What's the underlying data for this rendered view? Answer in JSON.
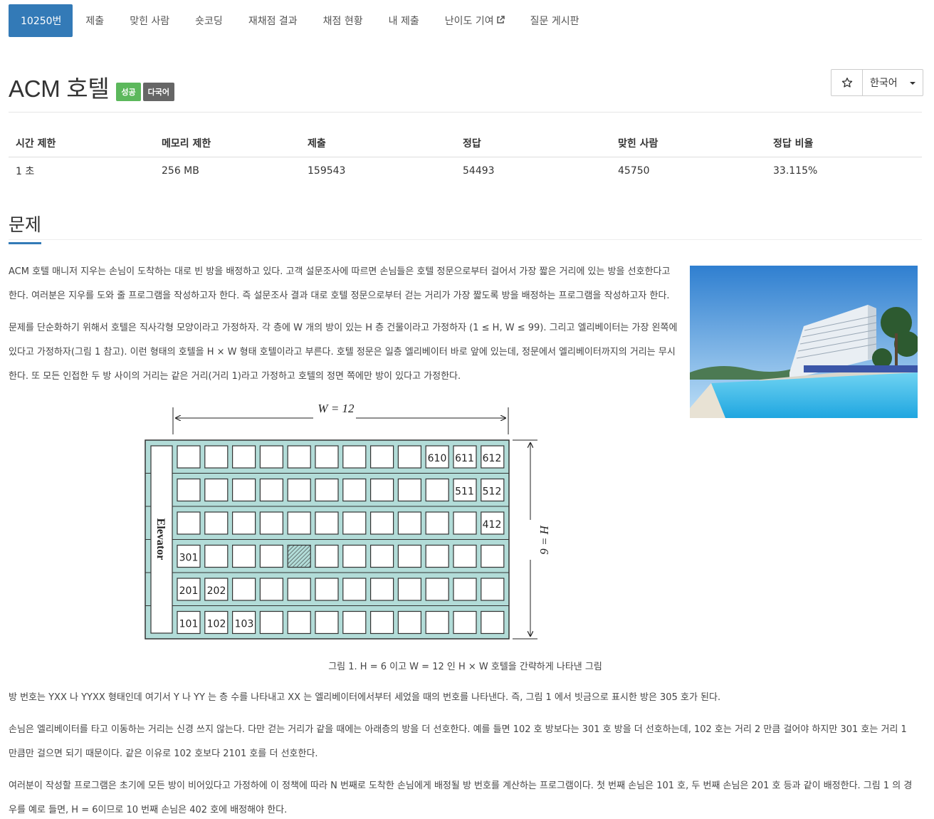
{
  "tabs": [
    {
      "label": "10250번",
      "active": true
    },
    {
      "label": "제출"
    },
    {
      "label": "맞힌 사람"
    },
    {
      "label": "숏코딩"
    },
    {
      "label": "재채점 결과"
    },
    {
      "label": "채점 현황"
    },
    {
      "label": "내 제출"
    },
    {
      "label": "난이도 기여",
      "external": true
    },
    {
      "label": "질문 게시판"
    }
  ],
  "problem": {
    "title": "ACM 호텔",
    "badges": {
      "success": "성공",
      "multilang": "다국어"
    },
    "language": "한국어",
    "star_icon": "star-icon"
  },
  "info": {
    "headers": [
      "시간 제한",
      "메모리 제한",
      "제출",
      "정답",
      "맞힌 사람",
      "정답 비율"
    ],
    "values": [
      "1 초",
      "256 MB",
      "159543",
      "54493",
      "45750",
      "33.115%"
    ]
  },
  "section": {
    "title": "문제"
  },
  "paragraphs": {
    "p1a": "ACM 호텔 매니저 지우는 손님이 도착하는 대로 빈 방을 배정하고 있다. 고객 설문조사에 따르면 손님들은 호텔 정문으로부터 걸어서 가장 짧은 거리에 있는 방을 선호한다고",
    "p1b": "한다. 여러분은 지우를 도와 줄 프로그램을 작성하고자 한다. 즉 설문조사 결과 대로 호텔 정문으로부터 걷는 거리가 가장 짧도록 방을 배정하는 프로그램을 작성하고자 한다.",
    "p2a": "문제를 단순화하기 위해서 호텔은 직사각형 모양이라고 가정하자. 각 층에 W 개의 방이 있는 H 층 건물이라고 가정하자 (1 ≤ H, W ≤ 99). 그리고 엘리베이터는 가장 왼쪽에",
    "p2b": "있다고 가정하자(그림 1 참고). 이런 형태의 호텔을 H × W 형태 호텔이라고 부른다. 호텔 정문은 일층 엘리베이터 바로 앞에 있는데, 정문에서 엘리베이터까지의 거리는 무시",
    "p2c": "한다. 또 모든 인접한 두 방 사이의 거리는 같은 거리(거리 1)라고 가정하고 호텔의 정면 쪽에만 방이 있다고 가정한다.",
    "caption": "그림 1. H = 6 이고 W = 12 인 H × W 호텔을 간략하게 나타낸 그림",
    "p3": "방 번호는 YXX 나 YYXX 형태인데 여기서 Y 나 YY 는 층 수를 나타내고 XX 는 엘리베이터에서부터 세었을 때의 번호를 나타낸다. 즉, 그림 1 에서 빗금으로 표시한 방은 305 호가 된다.",
    "p4a": "손님은 엘리베이터를 타고 이동하는 거리는 신경 쓰지 않는다. 다만 걷는 거리가 같을 때에는 아래층의 방을 더 선호한다. 예를 들면 102 호 방보다는 301 호 방을 더 선호하는데, 102 호는 거리 2 만큼 걸어야 하지만 301 호는 거리 1",
    "p4b": "만큼만 걸으면 되기 때문이다. 같은 이유로 102 호보다 2101 호를 더 선호한다.",
    "p5a": "여러분이 작성할 프로그램은 초기에 모든 방이 비어있다고 가정하에 이 정책에 따라 N 번째로 도착한 손님에게 배정될 방 번호를 계산하는 프로그램이다. 첫 번째 손님은 101 호, 두 번째 손님은 201 호 등과 같이 배정한다. 그림 1 의 경",
    "p5b": "우를 예로 들면, H = 6이므로 10 번째 손님은 402 호에 배정해야 한다."
  },
  "figure": {
    "w_label": "W = 12",
    "h_label": "H = 6",
    "elevator_label": "Elevator",
    "rooms": {
      "r610": "610",
      "r611": "611",
      "r612": "612",
      "r511": "511",
      "r512": "512",
      "r412": "412",
      "r301": "301",
      "r201": "201",
      "r202": "202",
      "r101": "101",
      "r102": "102",
      "r103": "103"
    }
  }
}
